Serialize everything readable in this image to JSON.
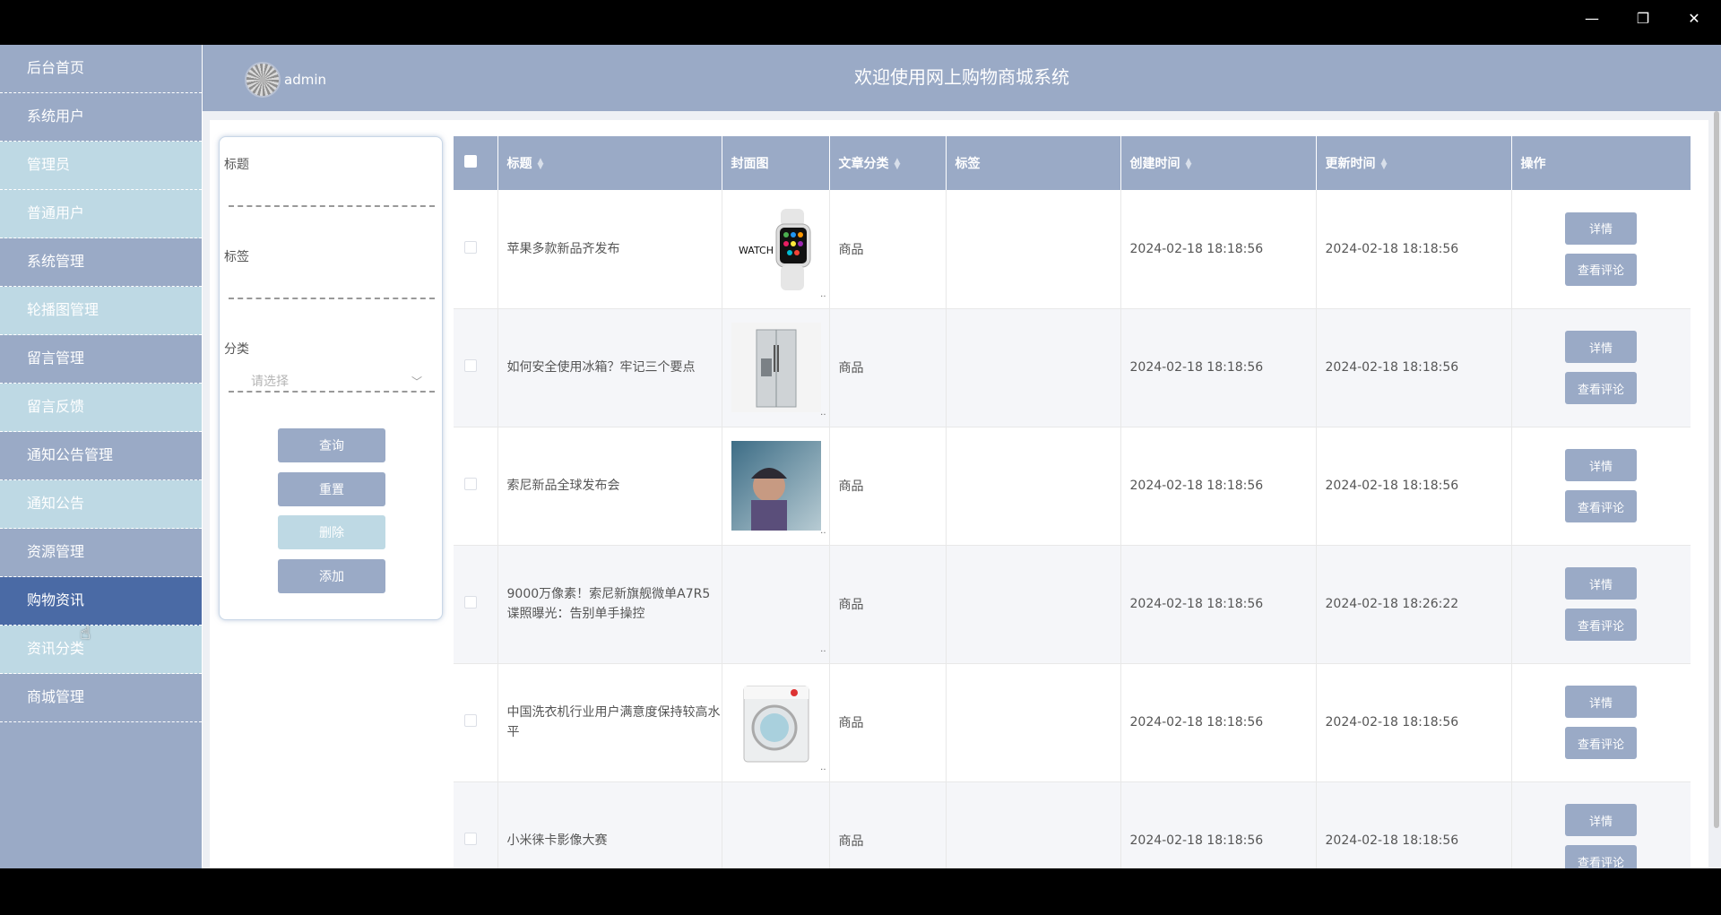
{
  "window": {
    "minimize": "—",
    "maximize": "❐",
    "close": "✕"
  },
  "sidebar": {
    "items": [
      {
        "label": "后台首页",
        "type": "main"
      },
      {
        "label": "系统用户",
        "type": "main"
      },
      {
        "label": "管理员",
        "type": "sub"
      },
      {
        "label": "普通用户",
        "type": "sub"
      },
      {
        "label": "系统管理",
        "type": "main"
      },
      {
        "label": "轮播图管理",
        "type": "sub"
      },
      {
        "label": "留言管理",
        "type": "main"
      },
      {
        "label": "留言反馈",
        "type": "sub"
      },
      {
        "label": "通知公告管理",
        "type": "main"
      },
      {
        "label": "通知公告",
        "type": "sub"
      },
      {
        "label": "资源管理",
        "type": "main"
      },
      {
        "label": "购物资讯",
        "type": "active"
      },
      {
        "label": "资讯分类",
        "type": "sub"
      },
      {
        "label": "商城管理",
        "type": "main"
      }
    ]
  },
  "header": {
    "username": "admin",
    "title": "欢迎使用网上购物商城系统"
  },
  "search": {
    "title_label": "标题",
    "tag_label": "标签",
    "category_label": "分类",
    "category_placeholder": "请选择",
    "query_btn": "查询",
    "reset_btn": "重置",
    "delete_btn": "删除",
    "add_btn": "添加"
  },
  "table": {
    "headers": {
      "title": "标题",
      "cover": "封面图",
      "category": "文章分类",
      "tag": "标签",
      "created": "创建时间",
      "updated": "更新时间",
      "ops": "操作"
    },
    "detail_label": "详情",
    "comment_label": "查看评论",
    "rows": [
      {
        "title": "苹果多款新品齐发布",
        "cover": "watch",
        "category": "商品",
        "tag": "",
        "created": "2024-02-18 18:18:56",
        "updated": "2024-02-18 18:18:56"
      },
      {
        "title": "如何安全使用冰箱？牢记三个要点",
        "cover": "fridge",
        "category": "商品",
        "tag": "",
        "created": "2024-02-18 18:18:56",
        "updated": "2024-02-18 18:18:56"
      },
      {
        "title": "索尼新品全球发布会",
        "cover": "photo",
        "category": "商品",
        "tag": "",
        "created": "2024-02-18 18:18:56",
        "updated": "2024-02-18 18:18:56"
      },
      {
        "title": "9000万像素！索尼新旗舰微单A7R5谍照曝光：告别单手操控",
        "cover": "none",
        "category": "商品",
        "tag": "",
        "created": "2024-02-18 18:18:56",
        "updated": "2024-02-18 18:26:22"
      },
      {
        "title": "中国洗衣机行业用户满意度保持较高水平",
        "cover": "washer",
        "category": "商品",
        "tag": "",
        "created": "2024-02-18 18:18:56",
        "updated": "2024-02-18 18:18:56"
      },
      {
        "title": "小米徕卡影像大赛",
        "cover": "none",
        "category": "商品",
        "tag": "",
        "created": "2024-02-18 18:18:56",
        "updated": "2024-02-18 18:18:56"
      }
    ]
  },
  "colors": {
    "primary": "#9aaac6",
    "accent_light": "#bed9e4",
    "active": "#4a6aa5"
  }
}
